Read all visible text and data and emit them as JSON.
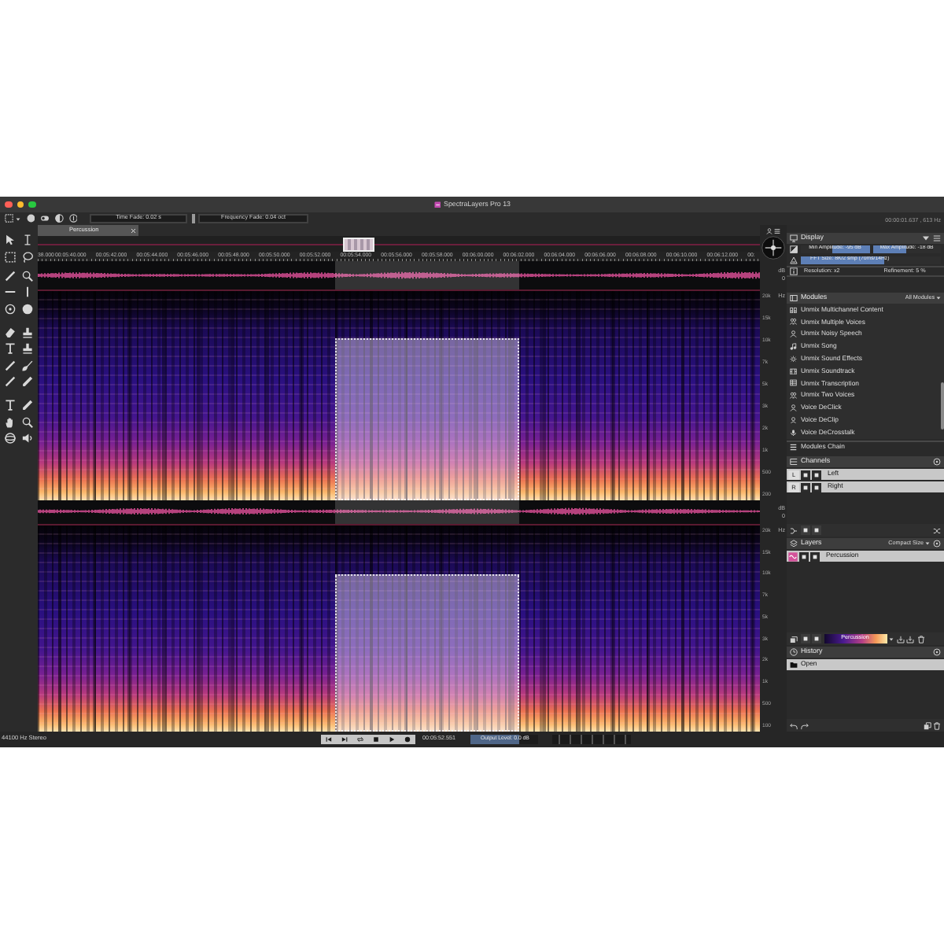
{
  "window": {
    "title": "SpectraLayers Pro 13"
  },
  "toolbar": {
    "time_fade": "Time Fade: 0.02 s",
    "frequency_fade": "Frequency Fade: 0.04 oct",
    "cursor_readout": "00:00:01.637 , 613 Hz"
  },
  "tabs": [
    {
      "label": "Percussion",
      "selected": true
    }
  ],
  "timeline": {
    "ticks": [
      "38.000",
      "00:05:40.000",
      "00:05:42.000",
      "00:05:44.000",
      "00:05:46.000",
      "00:05:48.000",
      "00:05:50.000",
      "00:05:52.000",
      "00:05:54.000",
      "00:05:56.000",
      "00:05:58.000",
      "00:06:00.000",
      "00:06:02.000",
      "00:06:04.000",
      "00:06:06.000",
      "00:06:08.000",
      "00:06:10.000",
      "00:06:12.000",
      "00:"
    ]
  },
  "scales": [
    {
      "amplitude_labels": [
        "dB",
        "0"
      ],
      "unit": "Hz",
      "labels": [
        "20k",
        "15k",
        "10k",
        "7k",
        "5k",
        "3k",
        "2k",
        "1k",
        "500",
        "200"
      ]
    },
    {
      "amplitude_labels": [
        "dB",
        "0"
      ],
      "unit": "Hz",
      "labels": [
        "20k",
        "15k",
        "10k",
        "7k",
        "5k",
        "3k",
        "2k",
        "1k",
        "500",
        "100"
      ]
    }
  ],
  "display": {
    "title": "Display",
    "min_amplitude": {
      "label": "Min Amplitude: -95 dB",
      "level": 0.55
    },
    "max_amplitude": {
      "label": "Max Amplitude: -18 dB",
      "level": 0.5
    },
    "fft_size": {
      "label": "FFT Size: 8K/2 smp (70ms/14Hz)",
      "level": 0.6
    },
    "resolution": "Resolution: x2",
    "refinement": "Refinement: 5 %"
  },
  "modules": {
    "title": "Modules",
    "filter": "All Modules",
    "items": [
      "Unmix Multichannel Content",
      "Unmix Multiple Voices",
      "Unmix Noisy Speech",
      "Unmix Song",
      "Unmix Sound Effects",
      "Unmix Soundtrack",
      "Unmix Transcription",
      "Unmix Two Voices",
      "Voice DeClick",
      "Voice DeClip",
      "Voice DeCrosstalk"
    ],
    "chain": "Modules Chain"
  },
  "channels": {
    "title": "Channels",
    "items": [
      {
        "letter": "L",
        "name": "Left",
        "selected": true
      },
      {
        "letter": "R",
        "name": "Right",
        "selected": true
      }
    ]
  },
  "layers": {
    "title": "Layers",
    "size": "Compact Size",
    "items": [
      {
        "name": "Percussion",
        "selected": true
      }
    ],
    "colormap_label": "Percussion"
  },
  "history": {
    "title": "History",
    "items": [
      {
        "label": "Open",
        "selected": true
      }
    ]
  },
  "status_bar": {
    "format": "44100 Hz Stereo",
    "time": "00:05:52.551",
    "output_level": {
      "label": "Output Level: 0.0 dB",
      "level": 0.72
    }
  }
}
